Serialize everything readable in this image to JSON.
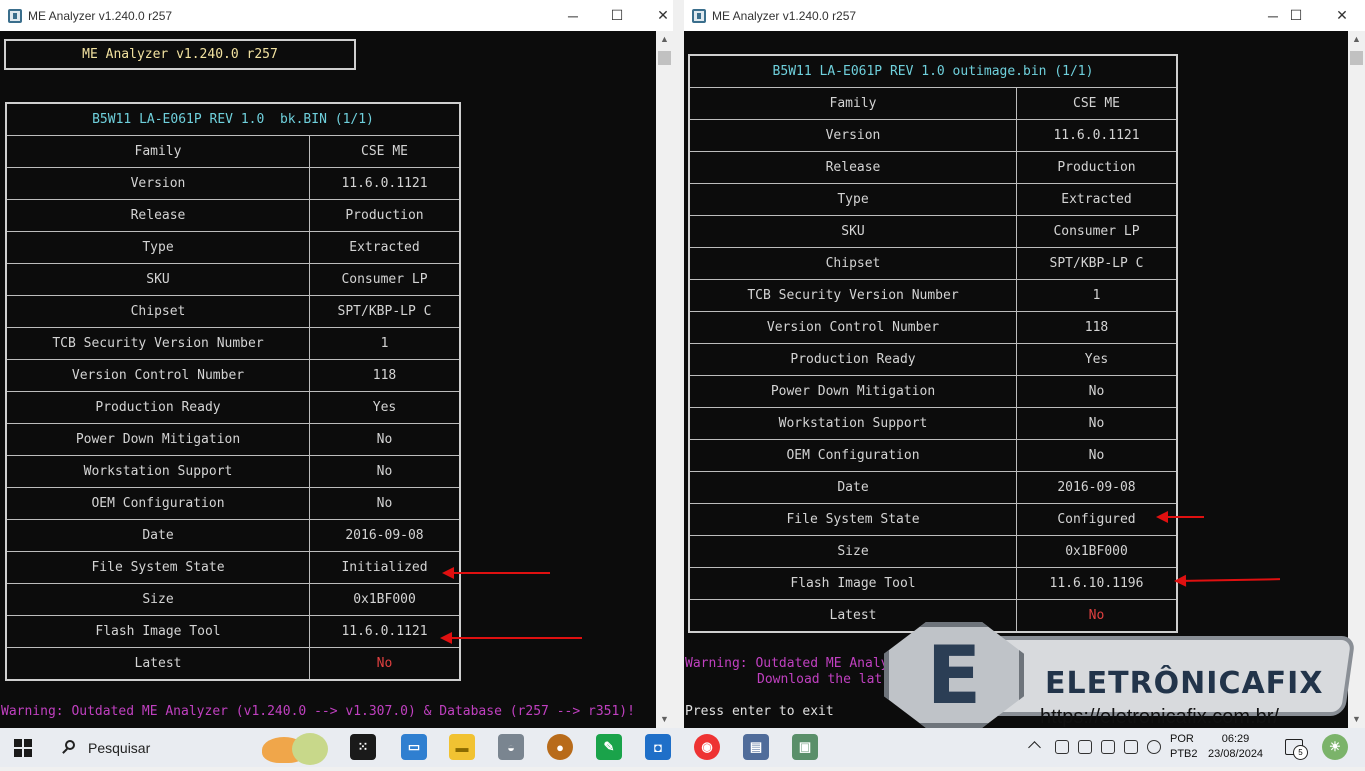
{
  "left_window": {
    "title": "ME Analyzer v1.240.0 r257",
    "header_box": "ME Analyzer v1.240.0 r257",
    "table_caption": "B5W11 LA-E061P REV 1.0  bk.BIN (1/1)",
    "rows": [
      {
        "key": "Family",
        "value": "CSE ME"
      },
      {
        "key": "Version",
        "value": "11.6.0.1121"
      },
      {
        "key": "Release",
        "value": "Production"
      },
      {
        "key": "Type",
        "value": "Extracted"
      },
      {
        "key": "SKU",
        "value": "Consumer LP"
      },
      {
        "key": "Chipset",
        "value": "SPT/KBP-LP C"
      },
      {
        "key": "TCB Security Version Number",
        "value": "1"
      },
      {
        "key": "Version Control Number",
        "value": "118"
      },
      {
        "key": "Production Ready",
        "value": "Yes"
      },
      {
        "key": "Power Down Mitigation",
        "value": "No"
      },
      {
        "key": "Workstation Support",
        "value": "No"
      },
      {
        "key": "OEM Configuration",
        "value": "No"
      },
      {
        "key": "Date",
        "value": "2016-09-08"
      },
      {
        "key": "File System State",
        "value": "Initialized"
      },
      {
        "key": "Size",
        "value": "0x1BF000"
      },
      {
        "key": "Flash Image Tool",
        "value": "11.6.0.1121"
      },
      {
        "key": "Latest",
        "value": "No"
      }
    ],
    "warning": "Warning: Outdated ME Analyzer (v1.240.0 --> v1.307.0) & Database (r257 --> r351)!"
  },
  "right_window": {
    "title": "ME Analyzer v1.240.0 r257",
    "table_caption": "B5W11 LA-E061P REV 1.0 outimage.bin (1/1)",
    "rows": [
      {
        "key": "Family",
        "value": "CSE ME"
      },
      {
        "key": "Version",
        "value": "11.6.0.1121"
      },
      {
        "key": "Release",
        "value": "Production"
      },
      {
        "key": "Type",
        "value": "Extracted"
      },
      {
        "key": "SKU",
        "value": "Consumer LP"
      },
      {
        "key": "Chipset",
        "value": "SPT/KBP-LP C"
      },
      {
        "key": "TCB Security Version Number",
        "value": "1"
      },
      {
        "key": "Version Control Number",
        "value": "118"
      },
      {
        "key": "Production Ready",
        "value": "Yes"
      },
      {
        "key": "Power Down Mitigation",
        "value": "No"
      },
      {
        "key": "Workstation Support",
        "value": "No"
      },
      {
        "key": "OEM Configuration",
        "value": "No"
      },
      {
        "key": "Date",
        "value": "2016-09-08"
      },
      {
        "key": "File System State",
        "value": "Configured"
      },
      {
        "key": "Size",
        "value": "0x1BF000"
      },
      {
        "key": "Flash Image Tool",
        "value": "11.6.10.1196"
      },
      {
        "key": "Latest",
        "value": "No"
      }
    ],
    "warning_line1": "Warning: Outdated ME Analy",
    "warning_line2": "Download the lat",
    "prompt": "Press enter to exit"
  },
  "window_controls": {
    "minimize": "─",
    "maximize": "☐",
    "close": "✕"
  },
  "watermark": {
    "logo_letter": "E",
    "brand": "ELETRÔNICAFIX",
    "url": "https://eletronicafix.com.br/"
  },
  "taskbar": {
    "search_placeholder": "Pesquisar",
    "language_line1": "POR",
    "language_line2": "PTB2",
    "time": "06:29",
    "date": "23/08/2024",
    "notification_count": "5"
  },
  "colors": {
    "console_bg": "#0c0c0c",
    "caption_cyan": "#6fd0dc",
    "warning_magenta": "#c040c0",
    "no_red": "#e04040",
    "annotation_red": "#e01010"
  }
}
